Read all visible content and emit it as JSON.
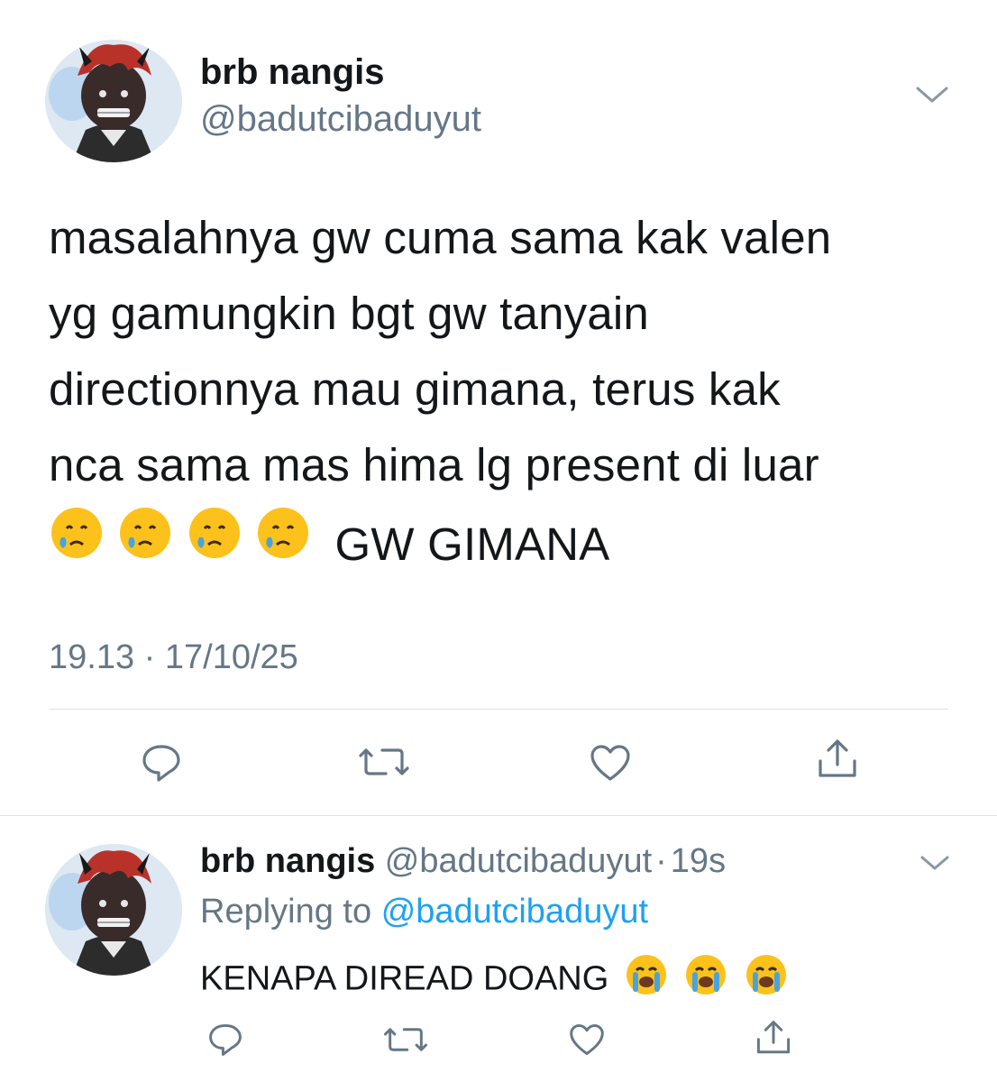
{
  "main_tweet": {
    "display_name": "brb nangis",
    "handle": "@badutcibaduyut",
    "text_lines": [
      "masalahnya gw cuma sama kak valen",
      "yg gamungkin bgt gw tanyain",
      "directionnya mau gimana, terus kak",
      "nca sama mas hima lg present di luar"
    ],
    "last_line_text": "GW GIMANA",
    "last_line_emoji": [
      "crying-face-emoji",
      "crying-face-emoji",
      "crying-face-emoji",
      "crying-face-emoji"
    ],
    "timestamp": "19.13 · 17/10/25"
  },
  "reply_tweet": {
    "display_name": "brb nangis",
    "handle": "@badutcibaduyut",
    "separator": "·",
    "age": "19s",
    "replying_prefix": "Replying to",
    "replying_handle": "@badutcibaduyut",
    "text": "KENAPA DIREAD DOANG",
    "emoji": [
      "loudly-crying-face-emoji",
      "loudly-crying-face-emoji",
      "loudly-crying-face-emoji"
    ]
  },
  "colors": {
    "text": "#14171a",
    "secondary": "#657786",
    "link": "#1da1f2",
    "divider": "#dfe3e6"
  }
}
